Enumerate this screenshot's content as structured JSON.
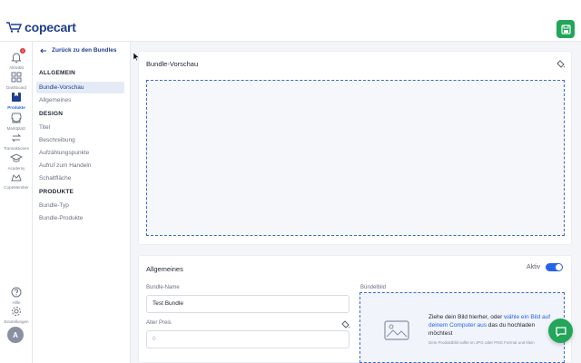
{
  "app": {
    "logo_text": "copecart",
    "save_label": "Save"
  },
  "rail": {
    "items": [
      {
        "label": "Aktivität",
        "icon": "bell-icon",
        "badge": "1"
      },
      {
        "label": "Dashboard",
        "icon": "grid-icon"
      },
      {
        "label": "Produkte",
        "icon": "box-icon"
      },
      {
        "label": "Marktplatz",
        "icon": "shop-icon"
      },
      {
        "label": "Transaktionen",
        "icon": "transfer-icon"
      },
      {
        "label": "Academy",
        "icon": "academy-icon"
      },
      {
        "label": "CopeMember",
        "icon": "member-icon"
      },
      {
        "label": "Hilfe",
        "icon": "help-icon"
      },
      {
        "label": "Einstellungen",
        "icon": "gear-icon"
      }
    ],
    "avatar_initial": "A"
  },
  "secnav": {
    "back_label": "Zurück zu den Bundles",
    "sections": [
      {
        "heading": "ALLGEMEIN",
        "items": [
          "Bundle-Vorschau",
          "Allgemeines"
        ]
      },
      {
        "heading": "DESIGN",
        "items": [
          "Titel",
          "Beschreibung",
          "Aufzählungspunkte",
          "Aufruf zum Handeln",
          "Schaltfläche"
        ]
      },
      {
        "heading": "PRODUKTE",
        "items": [
          "Bundle-Typ",
          "Bundle-Produkte"
        ]
      }
    ],
    "active_item": "Bundle-Vorschau"
  },
  "preview_card": {
    "title": "Bundle-Vorschau"
  },
  "general_card": {
    "title": "Allgemeines",
    "active_label": "Aktiv",
    "active": true,
    "bundle_name_label": "Bundle-Name",
    "bundle_name_value": "Test Bundle",
    "old_price_label": "Alter Preis",
    "old_price_placeholder": "0",
    "bundle_image_label": "Bündelbild",
    "upload_text_1": "Ziehe dein Bild hierher, oder",
    "upload_link": "wähle ein Bild auf deinem Computer aus",
    "upload_text_2": "das du hochladen möchtest",
    "upload_note": "Dein Produktbild sollte im JPG oder PNG Format und klein"
  },
  "colors": {
    "brand": "#1f3f8f",
    "accent": "#2563eb",
    "success": "#23a55a"
  }
}
